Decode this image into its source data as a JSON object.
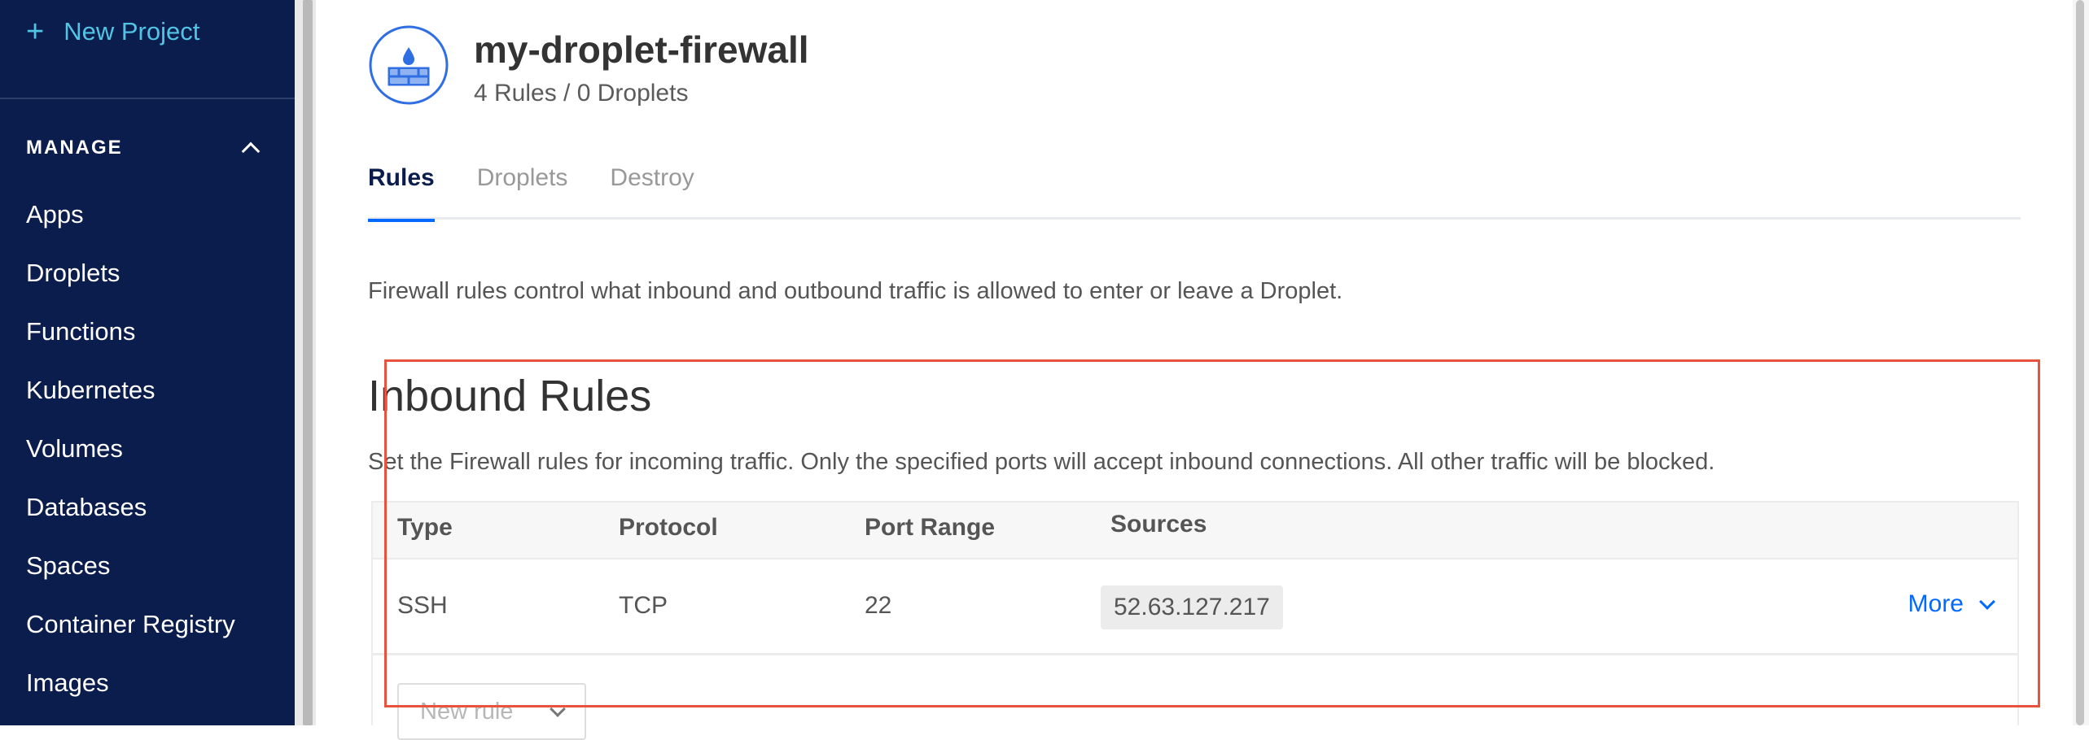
{
  "sidebar": {
    "new_project_label": "New Project",
    "manage_label": "MANAGE",
    "items": [
      {
        "label": "Apps"
      },
      {
        "label": "Droplets"
      },
      {
        "label": "Functions"
      },
      {
        "label": "Kubernetes"
      },
      {
        "label": "Volumes"
      },
      {
        "label": "Databases"
      },
      {
        "label": "Spaces"
      },
      {
        "label": "Container Registry"
      },
      {
        "label": "Images"
      }
    ]
  },
  "header": {
    "title": "my-droplet-firewall",
    "subtitle": "4 Rules / 0 Droplets",
    "icon": "firewall-icon"
  },
  "tabs": [
    {
      "label": "Rules",
      "active": true
    },
    {
      "label": "Droplets",
      "active": false
    },
    {
      "label": "Destroy",
      "active": false
    }
  ],
  "description": "Firewall rules control what inbound and outbound traffic is allowed to enter or leave a Droplet.",
  "inbound": {
    "title": "Inbound Rules",
    "description": "Set the Firewall rules for incoming traffic. Only the specified ports will accept inbound connections. All other traffic will be blocked.",
    "columns": [
      "Type",
      "Protocol",
      "Port Range",
      "Sources"
    ],
    "rows": [
      {
        "type": "SSH",
        "protocol": "TCP",
        "port_range": "22",
        "source": "52.63.127.217",
        "more_label": "More"
      }
    ],
    "new_rule_placeholder": "New rule"
  },
  "colors": {
    "sidebar_bg": "#0b1d4d",
    "accent": "#0069ff",
    "new_project": "#51c4e6",
    "highlight": "#e8533f"
  }
}
